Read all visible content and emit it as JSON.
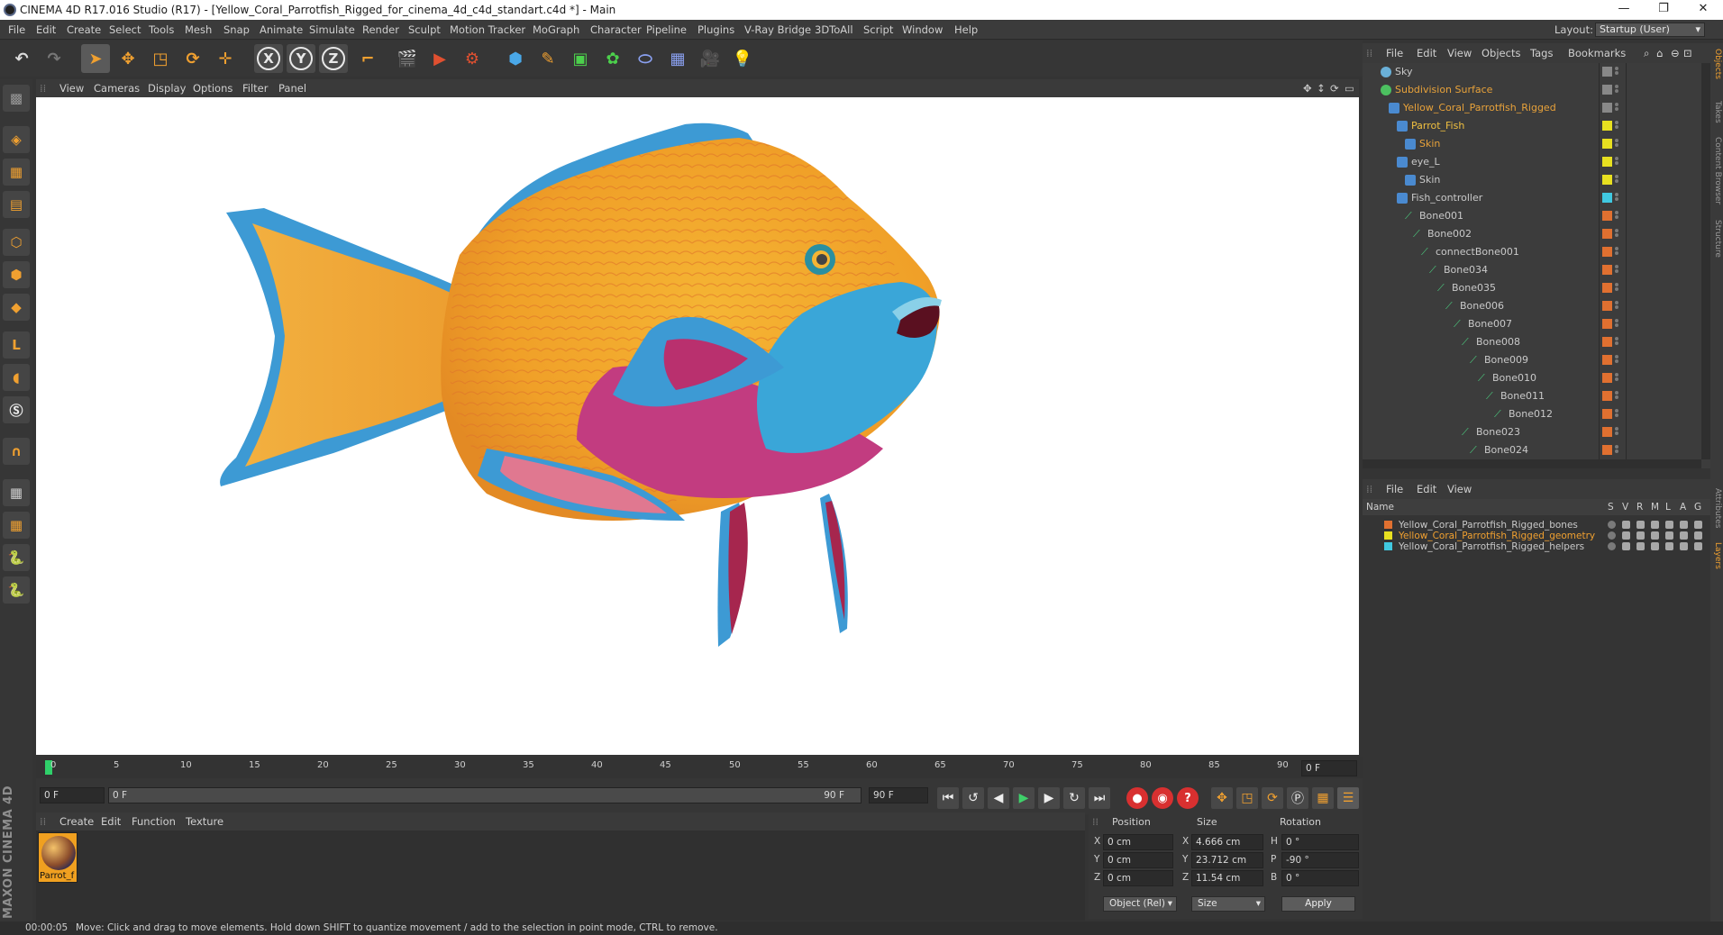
{
  "window": {
    "title": "CINEMA 4D R17.016 Studio (R17) - [Yellow_Coral_Parrotfish_Rigged_for_cinema_4d_c4d_standart.c4d *] - Main",
    "controls": [
      "—",
      "❐",
      "✕"
    ]
  },
  "menubar": {
    "items": [
      "File",
      "Edit",
      "Create",
      "Select",
      "Tools",
      "Mesh",
      "Snap",
      "Animate",
      "Simulate",
      "Render",
      "Sculpt",
      "Motion Tracker",
      "MoGraph",
      "Character",
      "Pipeline",
      "Plugins",
      "V-Ray Bridge",
      "3DToAll",
      "Script",
      "Window",
      "Help"
    ],
    "layout_label": "Layout:",
    "layout_value": "Startup (User)"
  },
  "viewport": {
    "menu": [
      "View",
      "Cameras",
      "Display",
      "Options",
      "Filter",
      "Panel"
    ]
  },
  "timeline": {
    "ticks": [
      "0",
      "5",
      "10",
      "15",
      "20",
      "25",
      "30",
      "35",
      "40",
      "45",
      "50",
      "55",
      "60",
      "65",
      "70",
      "75",
      "80",
      "85",
      "90"
    ],
    "current_frame_right": "0 F",
    "start_field": "0 F",
    "range_start": "0 F",
    "range_end": "90 F",
    "end_field": "90 F"
  },
  "materials": {
    "menu": [
      "Create",
      "Edit",
      "Function",
      "Texture"
    ],
    "items": [
      {
        "label": "Parrot_f"
      }
    ]
  },
  "coordinates": {
    "headers": [
      "Position",
      "Size",
      "Rotation"
    ],
    "position": [
      {
        "axis": "X",
        "value": "0 cm"
      },
      {
        "axis": "Y",
        "value": "0 cm"
      },
      {
        "axis": "Z",
        "value": "0 cm"
      }
    ],
    "size": [
      {
        "axis": "X",
        "value": "4.666 cm"
      },
      {
        "axis": "Y",
        "value": "23.712 cm"
      },
      {
        "axis": "Z",
        "value": "11.54 cm"
      }
    ],
    "rotation": [
      {
        "axis": "H",
        "value": "0 °"
      },
      {
        "axis": "P",
        "value": "-90 °"
      },
      {
        "axis": "B",
        "value": "0 °"
      }
    ],
    "mode_select": "Object (Rel)",
    "size_select": "Size",
    "apply_label": "Apply"
  },
  "status": {
    "time": "00:00:05",
    "message": "Move: Click and drag to move elements. Hold down SHIFT to quantize movement / add to the selection in point mode, CTRL to remove."
  },
  "brand": "MAXON CINEMA 4D",
  "object_manager": {
    "menu": [
      "File",
      "Edit",
      "View",
      "Objects",
      "Tags",
      "Bookmarks"
    ],
    "objects": [
      {
        "name": "Sky",
        "depth": 0,
        "color": "#c9c9c9",
        "tag": "#888888"
      },
      {
        "name": "Subdivision Surface",
        "depth": 0,
        "color": "#e8a23a",
        "tag": "#888888"
      },
      {
        "name": "Yellow_Coral_Parrotfish_Rigged",
        "depth": 1,
        "color": "#e8a23a",
        "tag": "#888888"
      },
      {
        "name": "Parrot_Fish",
        "depth": 2,
        "color": "#f0c040",
        "tag": "#e8e020"
      },
      {
        "name": "Skin",
        "depth": 3,
        "color": "#e8a23a",
        "tag": "#e8e020"
      },
      {
        "name": "eye_L",
        "depth": 2,
        "color": "#c9c9c9",
        "tag": "#e8e020"
      },
      {
        "name": "Skin",
        "depth": 3,
        "color": "#c9c9c9",
        "tag": "#e8e020"
      },
      {
        "name": "Fish_controller",
        "depth": 2,
        "color": "#c9c9c9",
        "tag": "#40c8e0"
      },
      {
        "name": "Bone001",
        "depth": 3,
        "color": "#c9c9c9",
        "tag": "#e07030"
      },
      {
        "name": "Bone002",
        "depth": 4,
        "color": "#c9c9c9",
        "tag": "#e07030"
      },
      {
        "name": "connectBone001",
        "depth": 5,
        "color": "#c9c9c9",
        "tag": "#e07030"
      },
      {
        "name": "Bone034",
        "depth": 6,
        "color": "#c9c9c9",
        "tag": "#e07030"
      },
      {
        "name": "Bone035",
        "depth": 7,
        "color": "#c9c9c9",
        "tag": "#e07030"
      },
      {
        "name": "Bone006",
        "depth": 8,
        "color": "#c9c9c9",
        "tag": "#e07030"
      },
      {
        "name": "Bone007",
        "depth": 9,
        "color": "#c9c9c9",
        "tag": "#e07030"
      },
      {
        "name": "Bone008",
        "depth": 10,
        "color": "#c9c9c9",
        "tag": "#e07030"
      },
      {
        "name": "Bone009",
        "depth": 11,
        "color": "#c9c9c9",
        "tag": "#e07030"
      },
      {
        "name": "Bone010",
        "depth": 12,
        "color": "#c9c9c9",
        "tag": "#e07030"
      },
      {
        "name": "Bone011",
        "depth": 13,
        "color": "#c9c9c9",
        "tag": "#e07030"
      },
      {
        "name": "Bone012",
        "depth": 14,
        "color": "#c9c9c9",
        "tag": "#e07030"
      },
      {
        "name": "Bone023",
        "depth": 10,
        "color": "#c9c9c9",
        "tag": "#e07030"
      },
      {
        "name": "Bone024",
        "depth": 11,
        "color": "#c9c9c9",
        "tag": "#e07030"
      }
    ]
  },
  "layer_manager": {
    "menu": [
      "File",
      "Edit",
      "View"
    ],
    "columns": [
      "Name",
      "S",
      "V",
      "R",
      "M",
      "L",
      "A",
      "G"
    ],
    "layers": [
      {
        "name": "Yellow_Coral_Parrotfish_Rigged_bones",
        "color": "#e07030",
        "text_color": "#c9c9c9"
      },
      {
        "name": "Yellow_Coral_Parrotfish_Rigged_geometry",
        "color": "#e8e020",
        "text_color": "#f0a030"
      },
      {
        "name": "Yellow_Coral_Parrotfish_Rigged_helpers",
        "color": "#40c8e0",
        "text_color": "#c9c9c9"
      }
    ]
  },
  "side_tabs": [
    "Objects",
    "Takes",
    "Content Browser",
    "Structure",
    "Attributes",
    "Layers"
  ],
  "colors": {
    "accent": "#f0a030",
    "panel": "#343434",
    "viewport_bg": "#ffffff",
    "selected_text": "#e8a23a"
  }
}
